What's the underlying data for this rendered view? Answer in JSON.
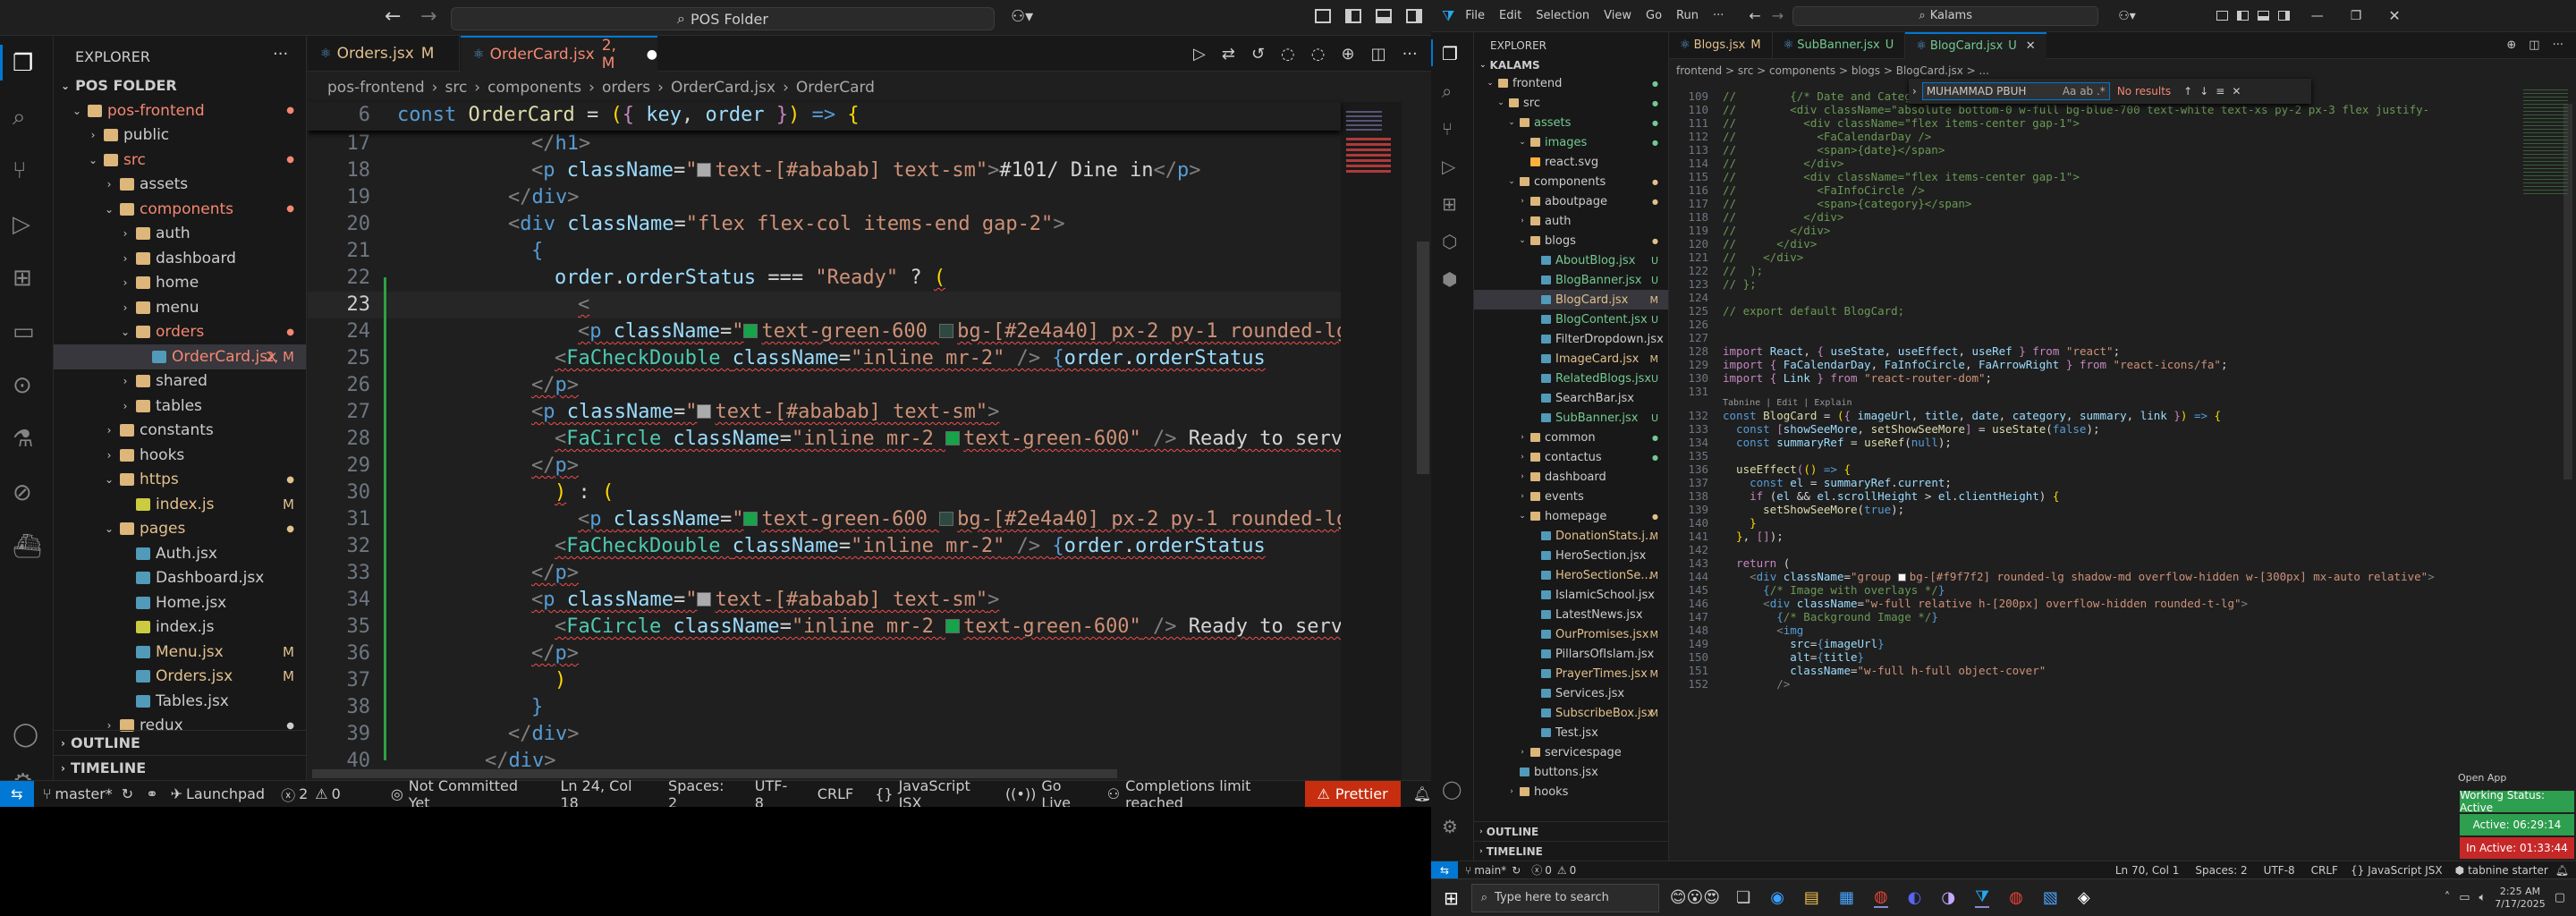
{
  "left": {
    "nav": {
      "back": "←",
      "forward": "→"
    },
    "search": "POS Folder",
    "tabs": [
      {
        "name": "Orders.jsx",
        "badge": "M",
        "active": false
      },
      {
        "name": "OrderCard.jsx",
        "badge": "2, M",
        "active": true
      }
    ],
    "explorer_title": "EXPLORER",
    "root": "POS FOLDER",
    "tree": [
      {
        "label": "pos-frontend",
        "indent": 1,
        "chev": "⌄",
        "color": "red",
        "dot": true
      },
      {
        "label": "public",
        "indent": 2,
        "chev": "›",
        "color": "#ccc",
        "dot": false
      },
      {
        "label": "src",
        "indent": 2,
        "chev": "⌄",
        "color": "red",
        "dot": true
      },
      {
        "label": "assets",
        "indent": 3,
        "chev": "›",
        "color": "#ccc",
        "dot": false
      },
      {
        "label": "components",
        "indent": 3,
        "chev": "⌄",
        "color": "red",
        "dot": true
      },
      {
        "label": "auth",
        "indent": 4,
        "chev": "›",
        "color": "#ccc",
        "dot": false
      },
      {
        "label": "dashboard",
        "indent": 4,
        "chev": "›",
        "color": "#ccc",
        "dot": false
      },
      {
        "label": "home",
        "indent": 4,
        "chev": "›",
        "color": "#ccc",
        "dot": false
      },
      {
        "label": "menu",
        "indent": 4,
        "chev": "›",
        "color": "#ccc",
        "dot": false
      },
      {
        "label": "orders",
        "indent": 4,
        "chev": "⌄",
        "color": "red",
        "dot": true
      },
      {
        "label": "OrderCard.jsx",
        "indent": 5,
        "chev": "",
        "color": "red",
        "badge": "2, M",
        "file": true,
        "selected": true
      },
      {
        "label": "shared",
        "indent": 4,
        "chev": "›",
        "color": "#ccc",
        "dot": false
      },
      {
        "label": "tables",
        "indent": 4,
        "chev": "›",
        "color": "#ccc",
        "dot": false
      },
      {
        "label": "constants",
        "indent": 3,
        "chev": "›",
        "color": "#ccc",
        "dot": false
      },
      {
        "label": "hooks",
        "indent": 3,
        "chev": "›",
        "color": "#ccc",
        "dot": false
      },
      {
        "label": "https",
        "indent": 3,
        "chev": "⌄",
        "color": "#e2c08d",
        "dot": true
      },
      {
        "label": "index.js",
        "indent": 4,
        "chev": "",
        "color": "#e2c08d",
        "badge": "M",
        "file": true
      },
      {
        "label": "pages",
        "indent": 3,
        "chev": "⌄",
        "color": "#e2c08d",
        "dot": true
      },
      {
        "label": "Auth.jsx",
        "indent": 4,
        "chev": "",
        "color": "#ccc",
        "file": true
      },
      {
        "label": "Dashboard.jsx",
        "indent": 4,
        "chev": "",
        "color": "#ccc",
        "file": true
      },
      {
        "label": "Home.jsx",
        "indent": 4,
        "chev": "",
        "color": "#ccc",
        "file": true
      },
      {
        "label": "index.js",
        "indent": 4,
        "chev": "",
        "color": "#ccc",
        "file": true
      },
      {
        "label": "Menu.jsx",
        "indent": 4,
        "chev": "",
        "color": "#e2c08d",
        "badge": "M",
        "file": true
      },
      {
        "label": "Orders.jsx",
        "indent": 4,
        "chev": "",
        "color": "#e2c08d",
        "badge": "M",
        "file": true
      },
      {
        "label": "Tables.jsx",
        "indent": 4,
        "chev": "",
        "color": "#ccc",
        "file": true
      },
      {
        "label": "redux",
        "indent": 3,
        "chev": "›",
        "color": "#ccc",
        "dot": true
      }
    ],
    "outline": "OUTLINE",
    "timeline": "TIMELINE",
    "breadcrumb": [
      "pos-frontend",
      "src",
      "components",
      "orders",
      "OrderCard.jsx",
      "OrderCard"
    ],
    "sticky": "const OrderCard = ({ key, order }) => {",
    "sticky_ln": "6",
    "status": {
      "branch": "master*",
      "launchpad": "Launchpad",
      "errors": "2",
      "warnings": "0",
      "commit": "Not Committed Yet",
      "pos": "Ln 24, Col 18",
      "spaces": "Spaces: 2",
      "enc": "UTF-8",
      "eol": "CRLF",
      "lang": "JavaScript JSX",
      "golive": "Go Live",
      "limit": "Completions limit reached",
      "prettier": "Prettier"
    }
  },
  "right": {
    "menu": [
      "File",
      "Edit",
      "Selection",
      "View",
      "Go",
      "Run",
      "···"
    ],
    "search": "Kalams",
    "tabs": [
      {
        "name": "Blogs.jsx",
        "badge": "M"
      },
      {
        "name": "SubBanner.jsx",
        "badge": "U"
      },
      {
        "name": "BlogCard.jsx",
        "badge": "U",
        "active": true
      }
    ],
    "explorer_title": "EXPLORER",
    "root": "KALAMS",
    "tree": [
      {
        "label": "frontend",
        "indent": 1,
        "chev": "⌄",
        "dot": "#73c991"
      },
      {
        "label": "src",
        "indent": 2,
        "chev": "⌄",
        "dot": "#73c991"
      },
      {
        "label": "assets",
        "indent": 3,
        "chev": "⌄",
        "dot": "#73c991",
        "color": "#73c991"
      },
      {
        "label": "images",
        "indent": 4,
        "chev": "⌄",
        "dot": "#73c991",
        "color": "#73c991"
      },
      {
        "label": "react.svg",
        "indent": 4,
        "file": true
      },
      {
        "label": "components",
        "indent": 3,
        "chev": "⌄",
        "dot": "#e2c08d"
      },
      {
        "label": "aboutpage",
        "indent": 4,
        "chev": "›",
        "dot": "#e2c08d"
      },
      {
        "label": "auth",
        "indent": 4,
        "chev": "›"
      },
      {
        "label": "blogs",
        "indent": 4,
        "chev": "⌄",
        "dot": "#e2c08d"
      },
      {
        "label": "AboutBlog.jsx",
        "indent": 5,
        "file": true,
        "badge": "U",
        "color": "#73c991"
      },
      {
        "label": "BlogBanner.jsx",
        "indent": 5,
        "file": true,
        "badge": "U",
        "color": "#73c991"
      },
      {
        "label": "BlogCard.jsx",
        "indent": 5,
        "file": true,
        "badge": "M",
        "color": "#e2c08d",
        "selected": true
      },
      {
        "label": "BlogContent.jsx",
        "indent": 5,
        "file": true,
        "badge": "U",
        "color": "#73c991"
      },
      {
        "label": "FilterDropdown.jsx",
        "indent": 5,
        "file": true
      },
      {
        "label": "ImageCard.jsx",
        "indent": 5,
        "file": true,
        "badge": "M",
        "color": "#e2c08d"
      },
      {
        "label": "RelatedBlogs.jsx",
        "indent": 5,
        "file": true,
        "badge": "U",
        "color": "#73c991"
      },
      {
        "label": "SearchBar.jsx",
        "indent": 5,
        "file": true
      },
      {
        "label": "SubBanner.jsx",
        "indent": 5,
        "file": true,
        "badge": "U",
        "color": "#73c991"
      },
      {
        "label": "common",
        "indent": 4,
        "chev": "›",
        "dot": "#73c991"
      },
      {
        "label": "contactus",
        "indent": 4,
        "chev": "›",
        "dot": "#73c991"
      },
      {
        "label": "dashboard",
        "indent": 4,
        "chev": "›"
      },
      {
        "label": "events",
        "indent": 4,
        "chev": "›"
      },
      {
        "label": "homepage",
        "indent": 4,
        "chev": "⌄",
        "dot": "#e2c08d"
      },
      {
        "label": "DonationStats.j...",
        "indent": 5,
        "file": true,
        "badge": "M",
        "color": "#e2c08d"
      },
      {
        "label": "HeroSection.jsx",
        "indent": 5,
        "file": true
      },
      {
        "label": "HeroSectionSe...",
        "indent": 5,
        "file": true,
        "badge": "M",
        "color": "#e2c08d"
      },
      {
        "label": "IslamicSchool.jsx",
        "indent": 5,
        "file": true
      },
      {
        "label": "LatestNews.jsx",
        "indent": 5,
        "file": true
      },
      {
        "label": "OurPromises.jsx",
        "indent": 5,
        "file": true,
        "badge": "M",
        "color": "#e2c08d"
      },
      {
        "label": "PillarsOfIslam.jsx",
        "indent": 5,
        "file": true
      },
      {
        "label": "PrayerTimes.jsx",
        "indent": 5,
        "file": true,
        "badge": "M",
        "color": "#e2c08d"
      },
      {
        "label": "Services.jsx",
        "indent": 5,
        "file": true
      },
      {
        "label": "SubscribeBox.jsx",
        "indent": 5,
        "file": true,
        "badge": "M",
        "color": "#e2c08d"
      },
      {
        "label": "Test.jsx",
        "indent": 5,
        "file": true
      },
      {
        "label": "servicespage",
        "indent": 4,
        "chev": "›"
      },
      {
        "label": "buttons.jsx",
        "indent": 3,
        "file": true
      },
      {
        "label": "hooks",
        "indent": 3,
        "chev": "›"
      }
    ],
    "outline": "OUTLINE",
    "timeline": "TIMELINE",
    "breadcrumb": "frontend > src > components > blogs > BlogCard.jsx > ...",
    "find": {
      "value": "MUHAMMAD PBUH",
      "result": "No results"
    },
    "codelens": "Tabnine | Edit | Explain",
    "status": {
      "branch": "main*",
      "errors": "0",
      "warnings": "0",
      "pos": "Ln 70, Col 1",
      "spaces": "Spaces: 2",
      "enc": "UTF-8",
      "eol": "CRLF",
      "lang": "JavaScript JSX",
      "tabnine": "tabnine starter"
    },
    "openapp": "Open App",
    "working": "Working Status: Active",
    "timer": "Active: 06:29:14",
    "inactive": "In Active: 01:33:44"
  },
  "taskbar": {
    "search": "Type here to search",
    "time": "2:25 AM",
    "date": "7/17/2025"
  }
}
